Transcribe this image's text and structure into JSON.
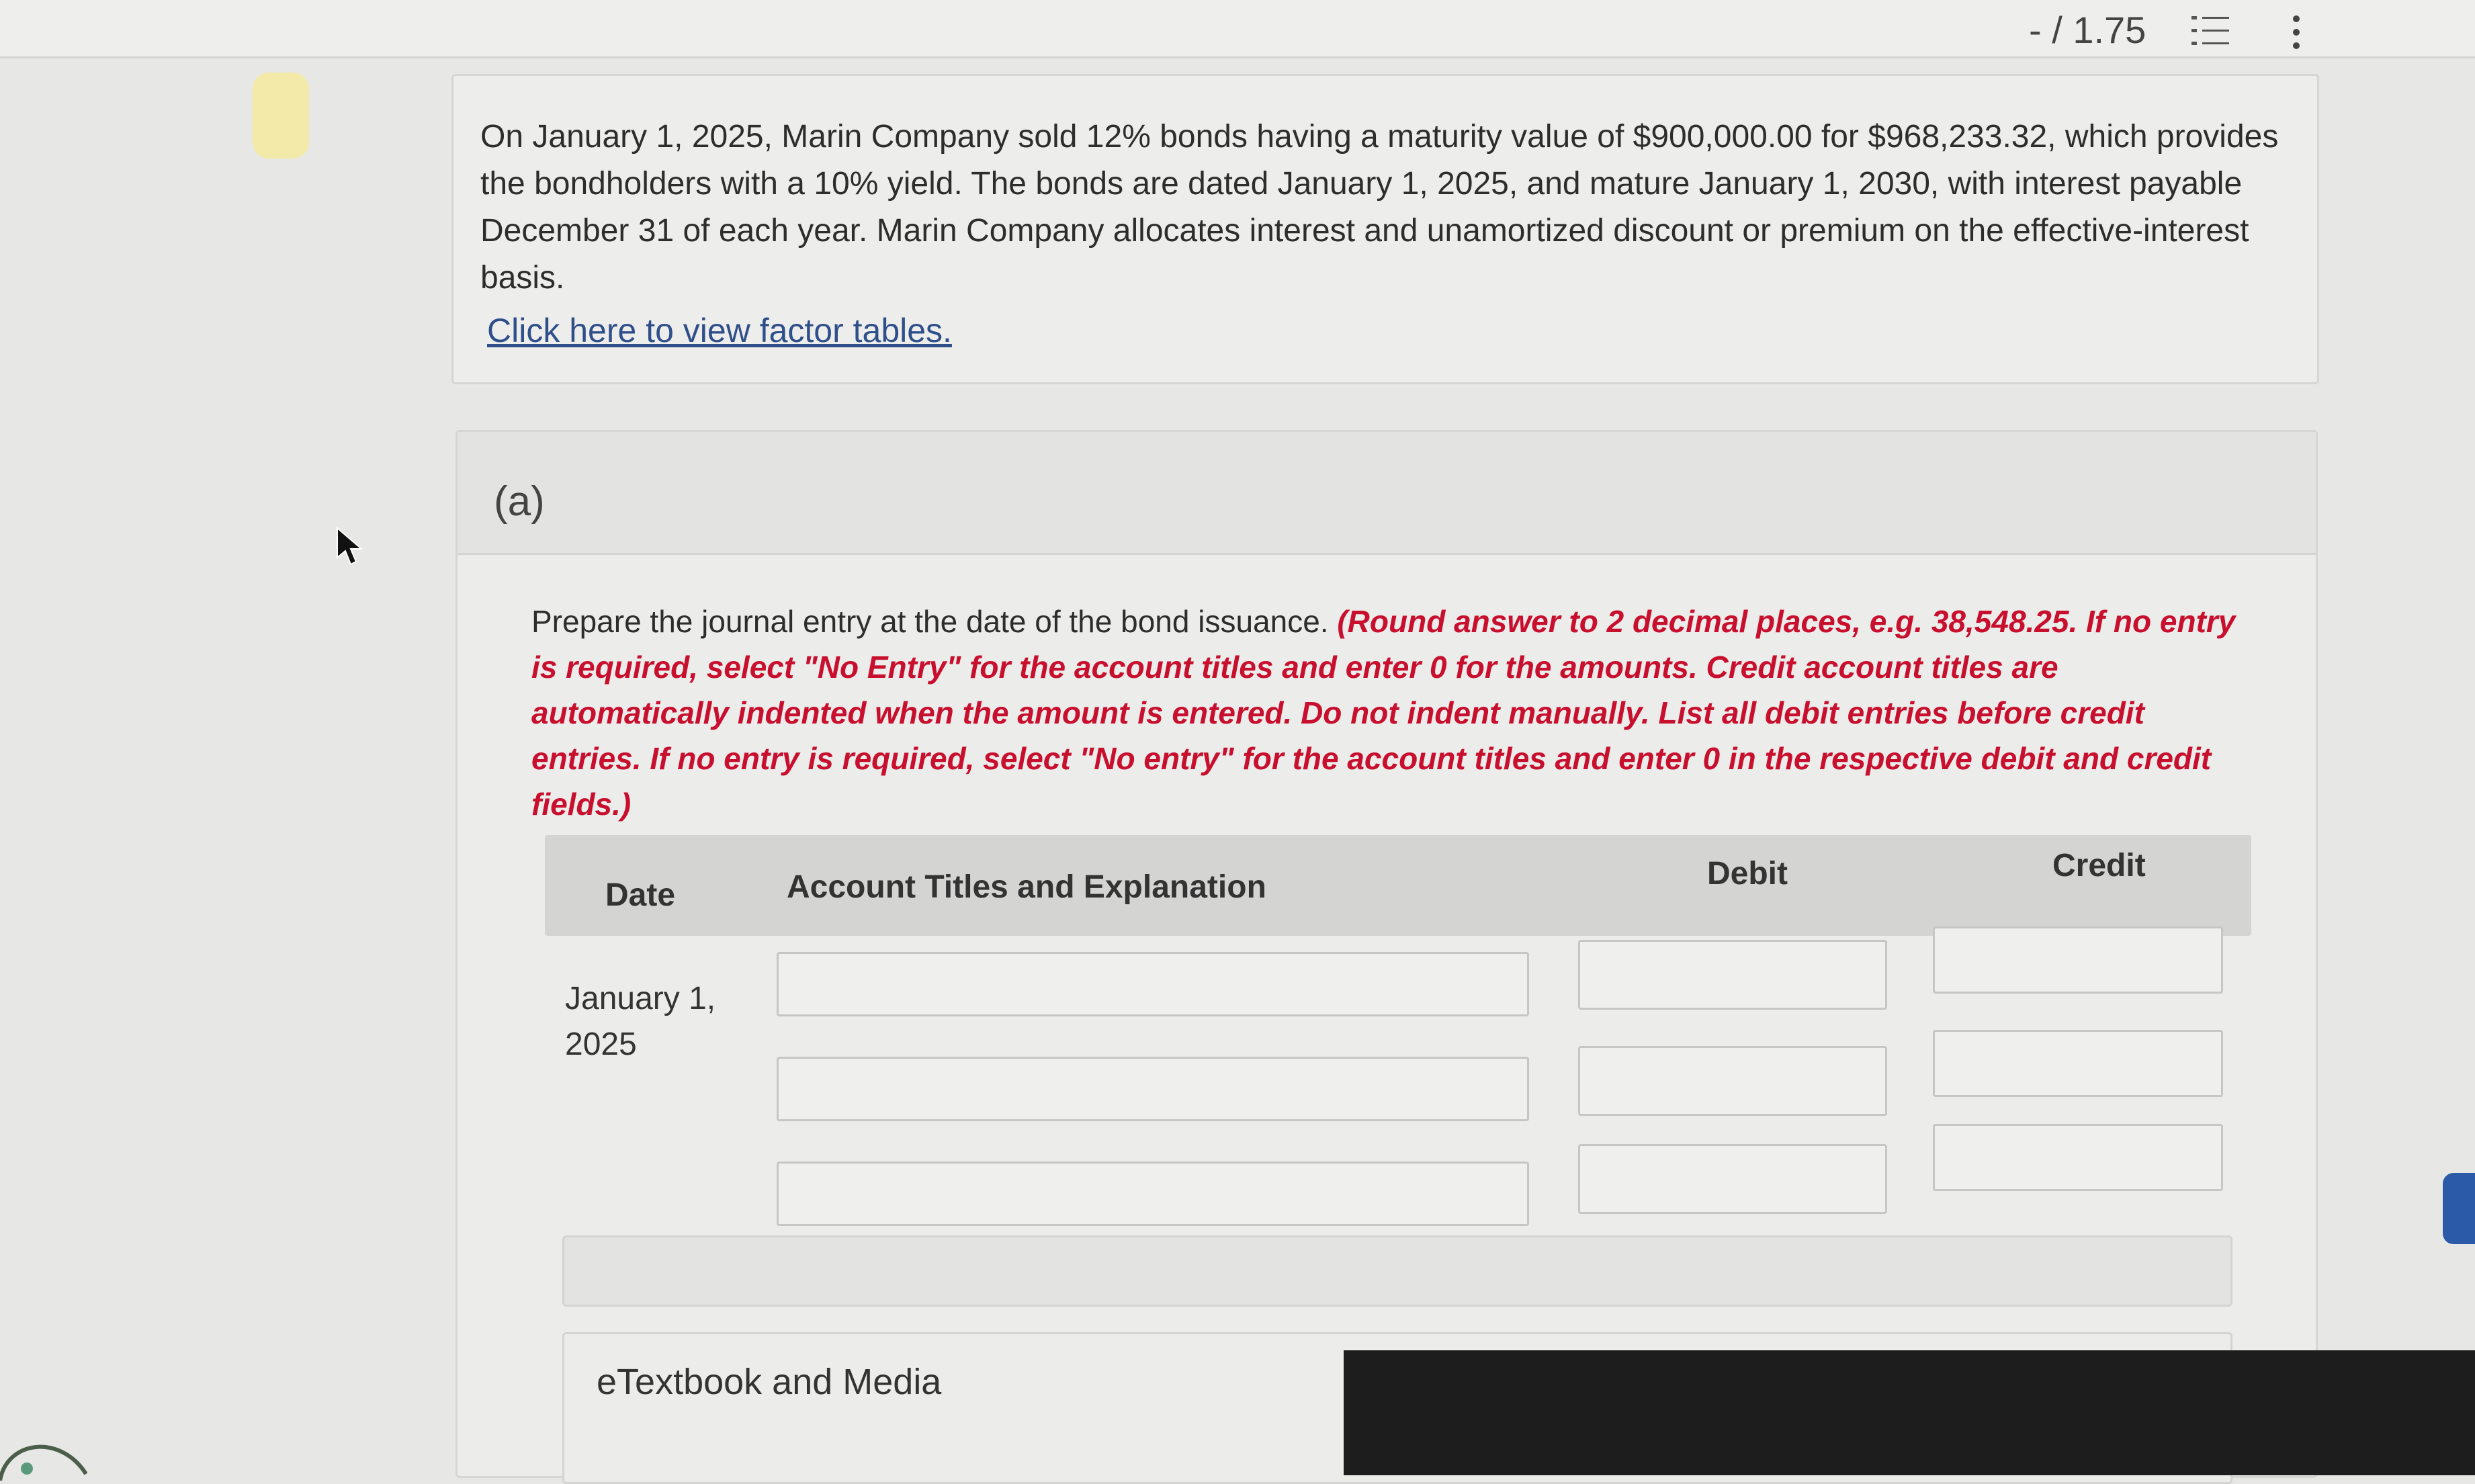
{
  "toolbar": {
    "score": "- / 1.75",
    "list_icon": "list-icon",
    "menu_icon": "kebab-menu-icon"
  },
  "problem": {
    "text": "On January 1, 2025, Marin Company sold 12% bonds having a maturity value of $900,000.00 for $968,233.32, which provides the bondholders with a 10% yield. The bonds are dated January 1, 2025, and mature January 1, 2030, with interest payable December 31 of each year. Marin Company allocates interest and unamortized discount or premium on the effective-interest basis.",
    "factor_link": "Click here to view factor tables."
  },
  "part": {
    "label": "(a)",
    "instruction_plain": "Prepare the journal entry at the date of the bond issuance. ",
    "instruction_red": "(Round answer to 2 decimal places, e.g. 38,548.25. If no entry is required, select \"No Entry\" for the account titles and enter 0 for the amounts. Credit account titles are automatically indented when the amount is entered. Do not indent manually. List all debit entries before credit entries. If no entry is required, select \"No entry\" for the account titles and enter 0 in the respective debit and credit fields.)"
  },
  "journal": {
    "headers": {
      "date": "Date",
      "account": "Account Titles and Explanation",
      "debit": "Debit",
      "credit": "Credit"
    },
    "date_line1": "January 1,",
    "date_line2": "2025",
    "rows": [
      {
        "account": "",
        "debit": "",
        "credit": ""
      },
      {
        "account": "",
        "debit": "",
        "credit": ""
      },
      {
        "account": "",
        "debit": "",
        "credit": ""
      }
    ]
  },
  "resources": {
    "etextbook": "eTextbook and Media"
  },
  "colors": {
    "instruction_red": "#c8102e",
    "link_blue": "#2f4f8a"
  }
}
